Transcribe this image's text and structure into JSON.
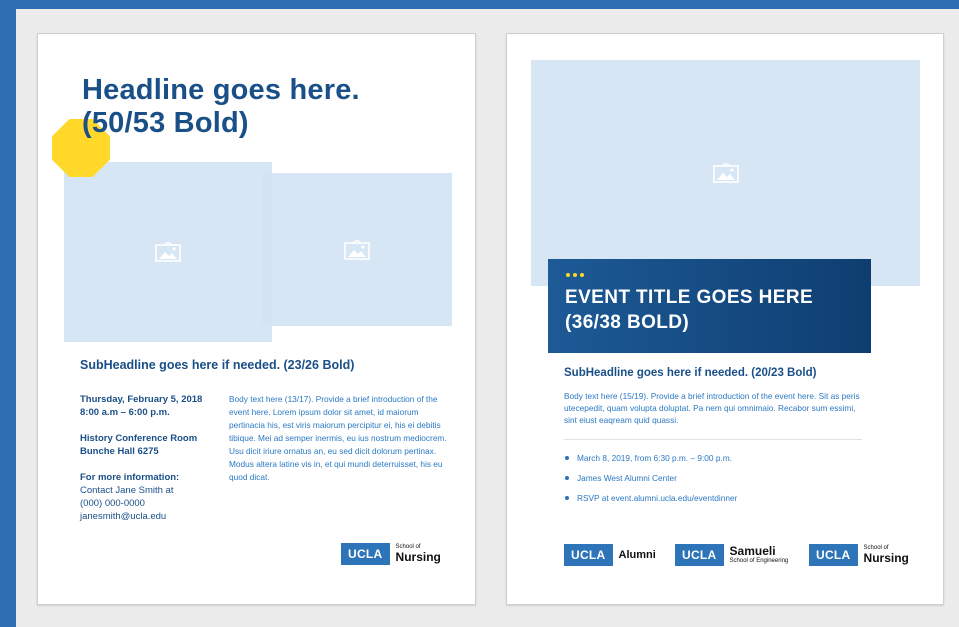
{
  "colors": {
    "frame_blue": "#2e6fb3",
    "headline_navy": "#1a4f87",
    "accent_yellow": "#ffd829",
    "image_placeholder": "#d3e4f4",
    "ucla_blue": "#2d74b8"
  },
  "icons": {
    "image_placeholder": "image-icon"
  },
  "left_page": {
    "headline_line1": "Headline goes here.",
    "headline_line2": "(50/53 Bold)",
    "subheadline": "SubHeadline goes here if needed. (23/26 Bold)",
    "date": "Thursday, February 5, 2018",
    "time": "8:00 a.m – 6:00 p.m.",
    "location_line1": "History Conference Room",
    "location_line2": "Bunche Hall 6275",
    "more_info_label": "For more information:",
    "contact_name": "Contact Jane Smith at",
    "contact_phone": "(000) 000-0000",
    "contact_email": "janesmith@ucla.edu",
    "body": "Body text here (13/17). Provide a brief introduction of the event here. Lorem ipsum dolor sit amet, id maiorum pertinacia his, est viris maiorum percipitur ei, his ei debitis tibique. Mei ad semper inermis, eu ius nostrum mediocrem. Usu dicit iriure ornatus an, eu sed dicit dolorum pertinax. Modus altera latine vis in, et qui mundi deterruisset, his eu quod dicat.",
    "logo": {
      "mark": "UCLA",
      "small": "School of",
      "name": "Nursing"
    }
  },
  "right_page": {
    "event_title_line1": "EVENT TITLE GOES HERE",
    "event_title_line2": "(36/38 BOLD)",
    "subheadline": "SubHeadline goes here if needed. (20/23 Bold)",
    "body": "Body text here (15/19). Provide a brief introduction of the event here. Sit as peris utecepedit, quam volupta doluptat. Pa nem qui omnimaio. Recabor sum essimi, sint eiust eaqream quid quassi.",
    "bullets": [
      "March 8, 2019, from 6:30 p.m. – 9:00 p.m.",
      "James West Alumni Center",
      "RSVP at event.alumni.ucla.edu/eventdinner"
    ],
    "logos": [
      {
        "mark": "UCLA",
        "name": "Alumni"
      },
      {
        "mark": "UCLA",
        "name": "Samueli",
        "small": "School of Engineering"
      },
      {
        "mark": "UCLA",
        "small": "School of",
        "name": "Nursing"
      }
    ]
  }
}
